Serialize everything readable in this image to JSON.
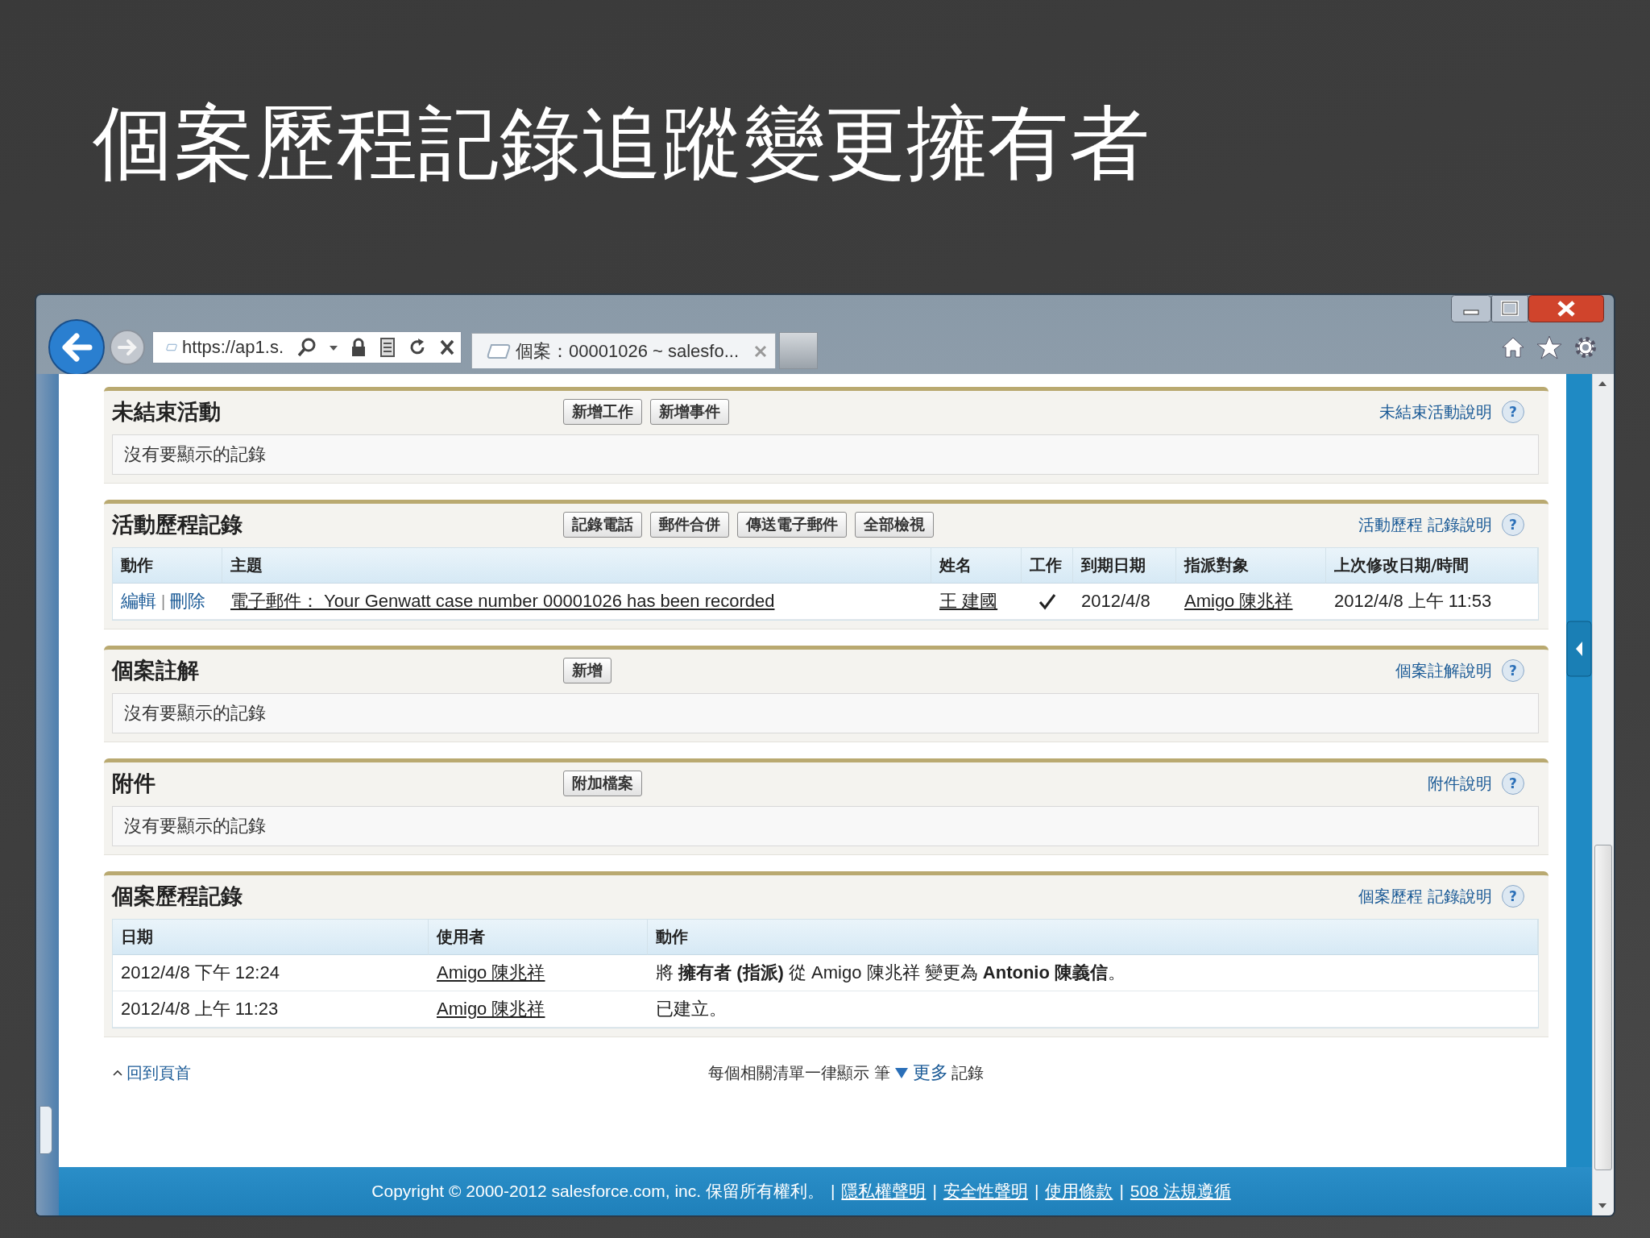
{
  "slide": {
    "title": "個案歷程記錄追蹤變更擁有者"
  },
  "browser": {
    "address": "https://ap1.s.",
    "tab_title": "個案：00001026 ~ salesfo..."
  },
  "sections": [
    {
      "kind": "empty",
      "title": "未結束活動",
      "buttons": [
        "新增工作",
        "新增事件"
      ],
      "help": "未結束活動說明",
      "help_mark": "?",
      "empty_text": "沒有要顯示的記錄"
    },
    {
      "kind": "activity",
      "title": "活動歷程記錄",
      "buttons": [
        "記錄電話",
        "郵件合併",
        "傳送電子郵件",
        "全部檢視"
      ],
      "help": "活動歷程 記錄說明",
      "help_mark": "?",
      "columns": [
        "動作",
        "主題",
        "姓名",
        "工作",
        "到期日期",
        "指派對象",
        "上次修改日期/時間"
      ],
      "rows": [
        {
          "edit": "編輯",
          "separator": "|",
          "delete": "刪除",
          "subject": "電子郵件： Your Genwatt case number 00001026 has been recorded",
          "name": "王 建國",
          "task": true,
          "due": "2012/4/8",
          "assigned": "Amigo 陳兆祥",
          "modified": "2012/4/8 上午 11:53"
        }
      ]
    },
    {
      "kind": "empty",
      "title": "個案註解",
      "buttons": [
        "新增"
      ],
      "help": "個案註解說明",
      "help_mark": "?",
      "empty_text": "沒有要顯示的記錄"
    },
    {
      "kind": "empty",
      "title": "附件",
      "buttons": [
        "附加檔案"
      ],
      "help": "附件說明",
      "help_mark": "?",
      "empty_text": "沒有要顯示的記錄"
    },
    {
      "kind": "history",
      "title": "個案歷程記錄",
      "help": "個案歷程 記錄說明",
      "help_mark": "?",
      "columns": [
        "日期",
        "使用者",
        "動作"
      ],
      "rows": [
        {
          "date": "2012/4/8 下午 12:24",
          "user": "Amigo 陳兆祥",
          "action": "將 **擁有者 (指派)** 從 Amigo 陳兆祥 變更為 **Antonio 陳義信**。"
        },
        {
          "date": "2012/4/8 上午 11:23",
          "user": "Amigo 陳兆祥",
          "action": "已建立。"
        }
      ]
    }
  ],
  "page_footer": {
    "back_to_top": "回到頁首",
    "per_list": "每個相關清單一律顯示 筆",
    "more": "更多",
    "records": "記錄"
  },
  "footer": {
    "copyright": "Copyright © 2000-2012 salesforce.com, inc. 保留所有權利。",
    "separator": "|",
    "links": [
      "隱私權聲明",
      "安全性聲明",
      "使用條款",
      "508 法規遵循"
    ]
  }
}
